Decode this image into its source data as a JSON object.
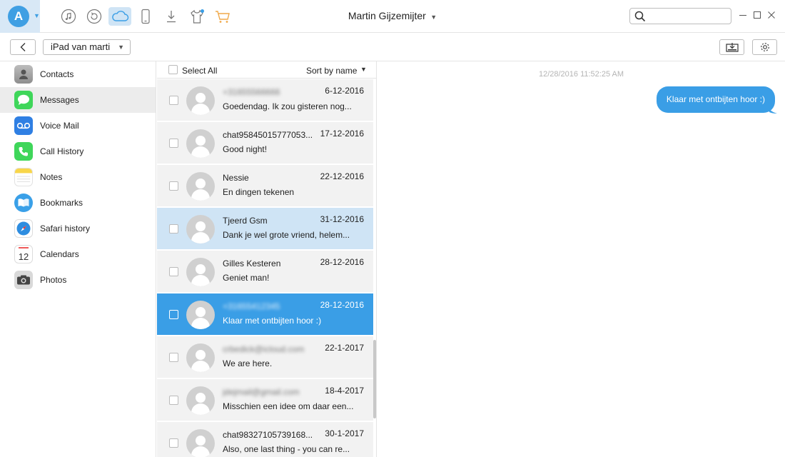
{
  "window": {
    "title": "Martin Gijzemijter",
    "brand_color": "#3a9ee6",
    "highlight_color": "#cfe4f5"
  },
  "toolbar": {
    "logo_letter": "A",
    "icons": [
      "music-icon",
      "restore-icon",
      "cloud-icon",
      "phone-device-icon",
      "download-icon",
      "tshirt-icon",
      "cart-icon"
    ],
    "active_icon": "cloud-icon"
  },
  "search": {
    "placeholder": "",
    "value": ""
  },
  "device": {
    "name": "iPad van marti"
  },
  "sidebar": {
    "items": [
      {
        "label": "Contacts",
        "icon": "contacts-icon"
      },
      {
        "label": "Messages",
        "icon": "messages-icon",
        "selected": true
      },
      {
        "label": "Voice Mail",
        "icon": "voicemail-icon"
      },
      {
        "label": "Call History",
        "icon": "phone-icon"
      },
      {
        "label": "Notes",
        "icon": "notes-icon"
      },
      {
        "label": "Bookmarks",
        "icon": "book-icon"
      },
      {
        "label": "Safari history",
        "icon": "safari-icon"
      },
      {
        "label": "Calendars",
        "icon": "calendar-icon"
      },
      {
        "label": "Photos",
        "icon": "camera-icon"
      }
    ]
  },
  "list": {
    "select_all": "Select All",
    "sort": "Sort by name",
    "rows": [
      {
        "name": "+31655566666",
        "blurred": true,
        "date": "6-12-2016",
        "preview": "Goedendag. Ik zou gisteren nog...",
        "state": ""
      },
      {
        "name": "chat95845015777053...",
        "blurred": false,
        "date": "17-12-2016",
        "preview": "Good night!",
        "state": ""
      },
      {
        "name": "Nessie",
        "blurred": false,
        "date": "22-12-2016",
        "preview": "En dingen tekenen",
        "state": ""
      },
      {
        "name": " Tjeerd Gsm",
        "blurred": false,
        "date": "31-12-2016",
        "preview": "Dank je wel grote vriend, helem...",
        "state": "hl"
      },
      {
        "name": "Gilles Kesteren",
        "blurred": false,
        "date": "28-12-2016",
        "preview": "Geniet man!",
        "state": ""
      },
      {
        "name": "+31655412345",
        "blurred": true,
        "date": "28-12-2016",
        "preview": "Klaar met ontbijten hoor :)",
        "state": "sel"
      },
      {
        "name": "crbedick@icloud.com",
        "blurred": true,
        "date": "22-1-2017",
        "preview": "We are here.",
        "state": ""
      },
      {
        "name": "jdejmail@gmail.com",
        "blurred": true,
        "date": "18-4-2017",
        "preview": "Misschien een idee om daar een...",
        "state": ""
      },
      {
        "name": "chat98327105739168...",
        "blurred": false,
        "date": "30-1-2017",
        "preview": "Also, one last thing - you can re...",
        "state": ""
      }
    ]
  },
  "chat": {
    "timestamp": "12/28/2016 11:52:25 AM",
    "message": "Klaar met ontbijten hoor :)"
  }
}
